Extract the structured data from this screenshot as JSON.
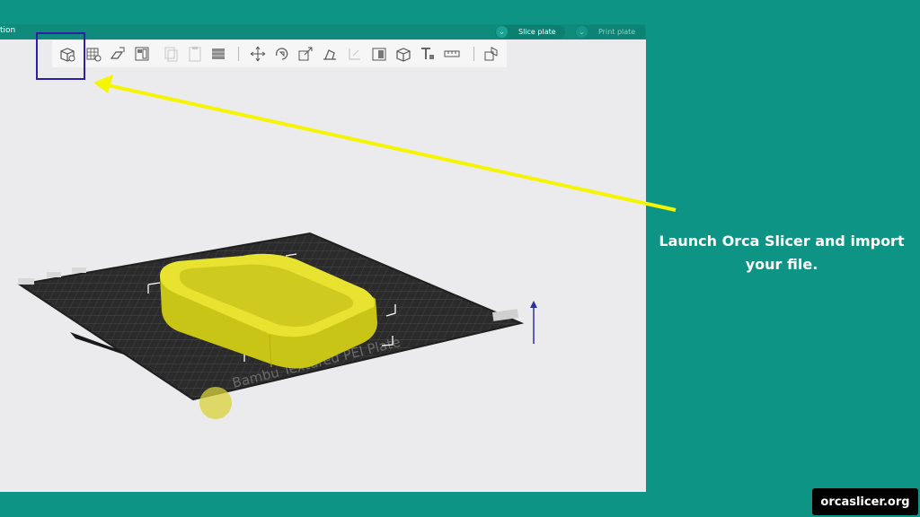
{
  "app": {
    "title_fragment": "tion",
    "slice_plate_label": "Slice plate",
    "print_plate_label": "Print plate",
    "dropdown_glyph": "⌄",
    "toolbar_icons": [
      "add-object-icon",
      "add-plate-icon",
      "auto-orient-icon",
      "arrange-icon",
      "copy-icon",
      "paste-icon",
      "layers-icon",
      "move-icon",
      "rotate-icon",
      "scale-icon",
      "lay-on-face-icon",
      "cut-icon",
      "support-paint-icon",
      "seam-paint-icon",
      "text-icon",
      "measure-icon",
      "assembly-icon"
    ],
    "bed_label": "Bambu Textured PEI Plate"
  },
  "annotation": {
    "caption": "Launch Orca Slicer and import your file.",
    "arrow_color": "#f5f500",
    "highlight_color": "#2b1fa6"
  },
  "brand": {
    "site": "orcaslicer.org",
    "background": "#0d9484"
  }
}
